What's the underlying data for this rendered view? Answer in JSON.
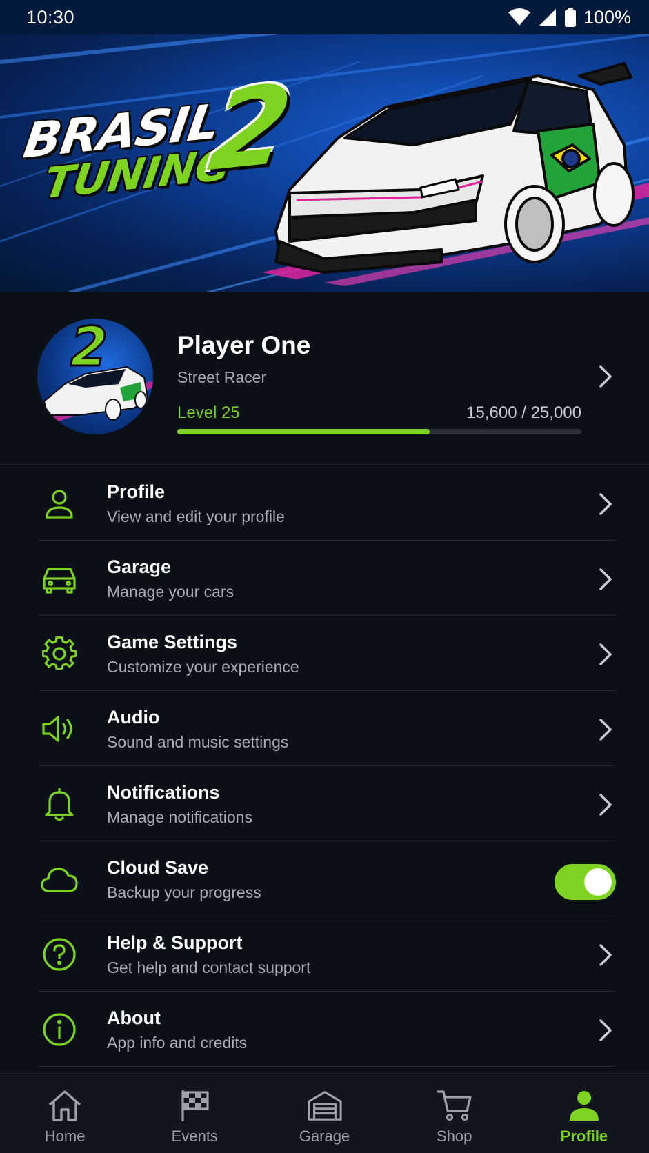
{
  "status_bar": {
    "time": "10:30",
    "battery": "100%"
  },
  "banner": {
    "logo_line1": "BRASIL",
    "logo_line2": "TUNING",
    "logo_number": "2"
  },
  "player": {
    "name": "Player One",
    "title": "Street Racer",
    "level_label": "Level 25",
    "xp_text": "15,600 / 25,000",
    "xp_progress": 0.624
  },
  "menu": {
    "items": [
      {
        "title": "Profile",
        "subtitle": "View and edit your profile",
        "icon": "user-icon"
      },
      {
        "title": "Garage",
        "subtitle": "Manage your cars",
        "icon": "car-icon"
      },
      {
        "title": "Game Settings",
        "subtitle": "Customize your experience",
        "icon": "gear-icon"
      },
      {
        "title": "Audio",
        "subtitle": "Sound and music settings",
        "icon": "speaker-icon"
      },
      {
        "title": "Notifications",
        "subtitle": "Manage notifications",
        "icon": "bell-icon"
      },
      {
        "title": "Cloud Save",
        "subtitle": "Backup your progress",
        "icon": "cloud-icon",
        "toggle_on": true
      },
      {
        "title": "Help & Support",
        "subtitle": "Get help and contact support",
        "icon": "question-icon"
      },
      {
        "title": "About",
        "subtitle": "App info and credits",
        "icon": "info-icon"
      }
    ]
  },
  "bottom_nav": {
    "items": [
      {
        "label": "Home",
        "icon": "home-icon"
      },
      {
        "label": "Events",
        "icon": "checkered-flag-icon"
      },
      {
        "label": "Garage",
        "icon": "garage-icon"
      },
      {
        "label": "Shop",
        "icon": "cart-icon"
      },
      {
        "label": "Profile",
        "icon": "user-filled-icon",
        "active": true
      }
    ]
  },
  "colors": {
    "accent": "#7ed321",
    "background": "#0b1016",
    "banner_blue": "#0d3f98",
    "text_secondary": "#a7adb5"
  }
}
